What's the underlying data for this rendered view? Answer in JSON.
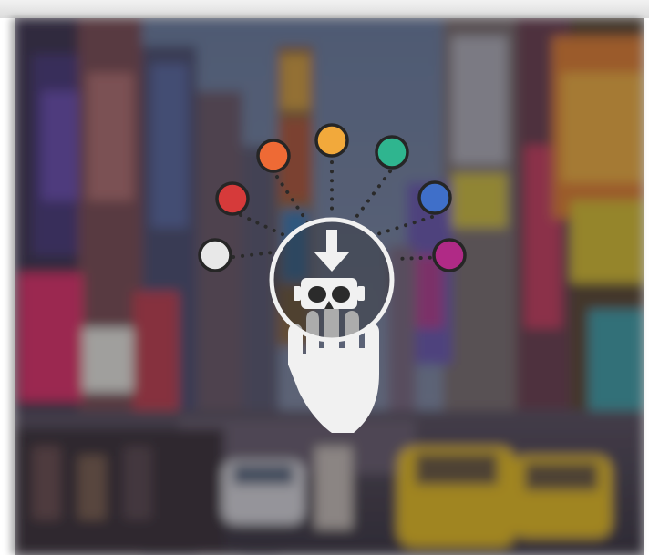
{
  "image": {
    "description_icon": "vr-headset-download-hand-icon",
    "scene": "blurred-city-street-background"
  },
  "palette": {
    "dot_colors": [
      "#e8e8e8",
      "#d63a3a",
      "#ee6a35",
      "#f2a93b",
      "#2fb58f",
      "#3f6fc9",
      "#b02a86"
    ],
    "icon_white": "#f1f1f1"
  }
}
